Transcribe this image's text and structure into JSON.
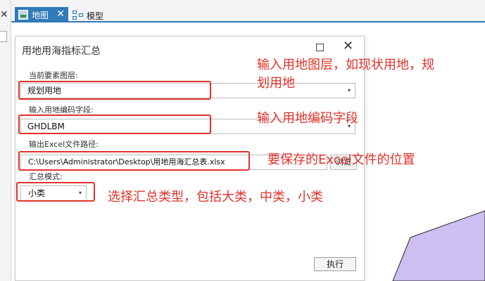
{
  "tabs": {
    "map_label": "地图",
    "map_close": "✕",
    "model_label": "模型"
  },
  "left_panel": {
    "close_glyph": "✕"
  },
  "dialog": {
    "title": "用地用海指标汇总",
    "close_glyph": "✕",
    "fields": {
      "layer_label": "当前要素图层:",
      "layer_value": "规划用地",
      "code_label": "输入用地编码字段:",
      "code_value": "GHDLBM",
      "excel_label": "输出Excel文件路径:",
      "excel_value": "C:\\Users\\Administrator\\Desktop\\用地用海汇总表.xlsx",
      "browse_label": "浏览",
      "mode_label": "汇总模式:",
      "mode_value": "小类"
    },
    "run_label": "执行",
    "dropdown_arrow": "▾"
  },
  "annotations": {
    "note1_line1": "输入用地图层，如现状用地，规",
    "note1_line2": "划用地",
    "note2": "输入用地编码字段",
    "note3": "要保存的Excel文件的位置",
    "note4": "选择汇总类型，包括大类，中类，小类"
  },
  "colors": {
    "accent": "#2f7ab9",
    "annotation": "#e0322b",
    "polygon_fill": "#cdbff2"
  }
}
